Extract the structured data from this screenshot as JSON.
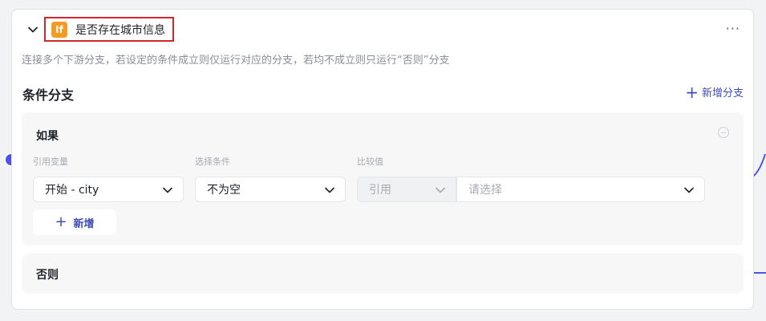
{
  "node": {
    "title": "是否存在城市信息",
    "icon_text": "If",
    "icon_color": "#f59a23",
    "more_label": "···",
    "description": "连接多个下游分支，若设定的条件成立则仅运行对应的分支，若均不成立则只运行“否则”分支"
  },
  "conditions": {
    "section_title": "条件分支",
    "add_branch_label": "新增分支",
    "if_branch": {
      "label": "如果",
      "field_labels": {
        "variable": "引用变量",
        "condition": "选择条件",
        "compare": "比较值"
      },
      "variable_value": "开始 - city",
      "condition_value": "不为空",
      "compare_type": "引用",
      "compare_placeholder": "请选择",
      "add_condition_label": "新增"
    },
    "else_branch": {
      "label": "否则"
    }
  },
  "colors": {
    "accent": "#4d53e8",
    "link": "#3d4db8",
    "highlight_border": "#d0282e"
  }
}
